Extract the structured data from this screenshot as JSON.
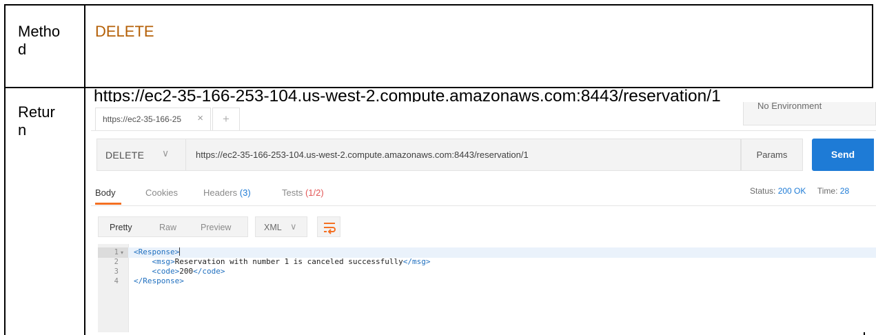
{
  "table": {
    "rows": [
      {
        "label": "Metho\nd",
        "value": "DELETE",
        "value_color": "#b45f06"
      },
      {
        "label": "Retur\nn",
        "value": "https://ec2-35-166-253-104.us-west-2.compute.amazonaws.com:8443/reservation/1"
      }
    ]
  },
  "postman": {
    "tab": {
      "label": "https://ec2-35-166-25",
      "close": "×"
    },
    "new_tab": "+",
    "environment": "No Environment",
    "request": {
      "method": "DELETE",
      "method_chevron": "∨",
      "url": "https://ec2-35-166-253-104.us-west-2.compute.amazonaws.com:8443/reservation/1",
      "params_label": "Params",
      "send_label": "Send"
    },
    "response_tabs": {
      "body": "Body",
      "cookies": "Cookies",
      "headers": "Headers",
      "headers_count": "(3)",
      "tests": "Tests",
      "tests_count": "(1/2)"
    },
    "status": {
      "status_label": "Status:",
      "status_value": "200 OK",
      "time_label": "Time:",
      "time_value": "28"
    },
    "format": {
      "pretty": "Pretty",
      "raw": "Raw",
      "preview": "Preview",
      "language": "XML",
      "language_chevron": "∨",
      "wrap_icon": "wrap-lines-icon"
    },
    "editor": {
      "line_numbers": [
        "1",
        "2",
        "3",
        "4"
      ],
      "fold_marker": "▾",
      "lines": [
        {
          "indent": "",
          "open": "<Response>",
          "text": "",
          "close": ""
        },
        {
          "indent": "    ",
          "open": "<msg>",
          "text": "Reservation with number 1 is canceled successfully",
          "close": "</msg>"
        },
        {
          "indent": "    ",
          "open": "<code>",
          "text": "200",
          "close": "</code>"
        },
        {
          "indent": "",
          "open": "</Response>",
          "text": "",
          "close": ""
        }
      ]
    },
    "colors": {
      "accent": "#f47023",
      "send": "#1e7bd6",
      "tag": "#1f6fbf"
    }
  }
}
